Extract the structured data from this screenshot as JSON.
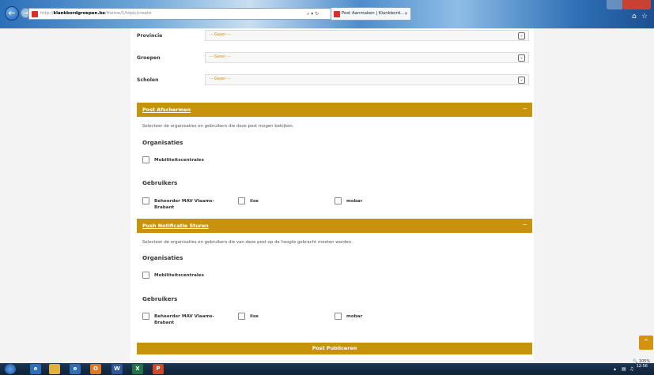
{
  "browser": {
    "url_prefix": "http://",
    "url_domain": "klankbordgroepen.be",
    "url_path": "/theme/1/topic/create",
    "addr_tools": "⌕ ▾ ↻",
    "tab_title": "Post Aanmaken | Klankbord...",
    "tab_close": "×"
  },
  "filters": [
    {
      "label": "Provincie",
      "value": "-- Geen --"
    },
    {
      "label": "Groepen",
      "value": "-- Geen --"
    },
    {
      "label": "Scholen",
      "value": "-- Geen --"
    }
  ],
  "section_afschermen": {
    "title": "Post Afschermen",
    "toggle": "−",
    "description": "Selecteer de organisaties en gebruikers die deze post mogen bekijken.",
    "org_heading": "Organisaties",
    "organisations": [
      "Mobiliteitscentrales"
    ],
    "user_heading": "Gebruikers",
    "users": [
      "Beheerder MAV Vlaams-\nBrabant",
      "ilse",
      "mobar"
    ]
  },
  "section_push": {
    "title": "Push Notificatie Sturen",
    "toggle": "−",
    "description": "Selecteer de organisaties en gebruikers die van deze post op de hoogte gebracht moeten worden.",
    "org_heading": "Organisaties",
    "organisations": [
      "Mobiliteitscentrales"
    ],
    "user_heading": "Gebruikers",
    "users": [
      "Beheerder MAV Vlaams-\nBrabant",
      "ilse",
      "mobar"
    ]
  },
  "publish_label": "Post Publiceren",
  "status": {
    "zoom": "🔍 105%"
  },
  "taskbar": {
    "items": [
      "ie",
      "folder",
      "ie",
      "outlook",
      "word",
      "excel",
      "powerpoint"
    ],
    "time": "12:56"
  }
}
